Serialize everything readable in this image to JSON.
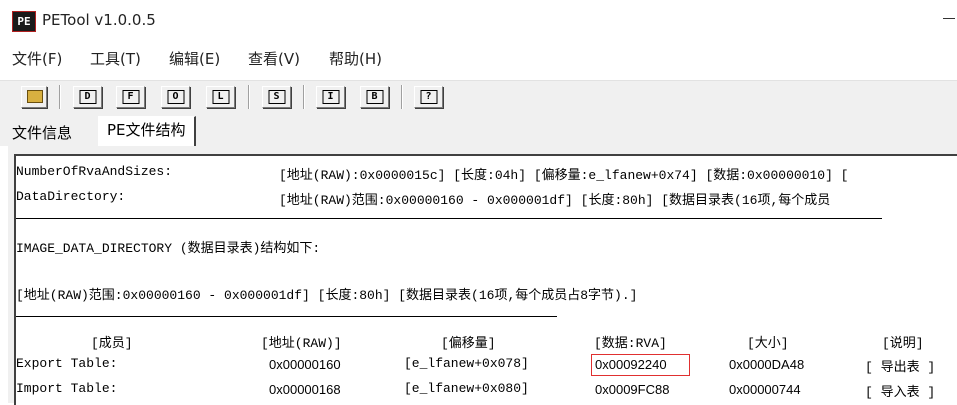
{
  "window": {
    "title": "PETool v1.0.0.5",
    "icon_text": "PE"
  },
  "menu": [
    {
      "label": "文件(F)"
    },
    {
      "label": "工具(T)"
    },
    {
      "label": "编辑(E)"
    },
    {
      "label": "查看(V)"
    },
    {
      "label": "帮助(H)"
    }
  ],
  "toolbar": {
    "buttons": [
      {
        "icon": "open-folder-icon",
        "letter": ""
      },
      {
        "icon": "d-icon",
        "letter": "D"
      },
      {
        "icon": "f-icon",
        "letter": "F"
      },
      {
        "icon": "o-icon",
        "letter": "O"
      },
      {
        "icon": "l-icon",
        "letter": "L"
      },
      {
        "icon": "s-icon",
        "letter": "S"
      },
      {
        "icon": "i-icon",
        "letter": "I"
      },
      {
        "icon": "b-icon",
        "letter": "B"
      },
      {
        "icon": "help-icon",
        "letter": "?"
      }
    ]
  },
  "tabs": [
    {
      "label": "文件信息",
      "active": false
    },
    {
      "label": "PE文件结构",
      "active": true
    }
  ],
  "content": {
    "line1_field": "NumberOfRvaAndSizes:",
    "line1_value": "[地址(RAW):0x0000015c] [长度:04h] [偏移量:e_lfanew+0x74] [数据:0x00000010] [",
    "line2_field": "DataDirectory:",
    "line2_value": "[地址(RAW)范围:0x00000160 - 0x000001df] [长度:80h] [数据目录表(16项,每个成员",
    "section_title": "IMAGE_DATA_DIRECTORY (数据目录表)结构如下:",
    "range_line": "[地址(RAW)范围:0x00000160 - 0x000001df] [长度:80h] [数据目录表(16项,每个成员占8字节).]",
    "table": {
      "headers": [
        "[成员]",
        "[地址(RAW)]",
        "[偏移量]",
        "[数据:RVA]",
        "[大小]",
        "[说明]"
      ],
      "rows": [
        {
          "member": "Export Table:",
          "addr": "0x00000160",
          "offset": "[e_lfanew+0x078]",
          "rva": "0x00092240",
          "size": "0x0000DA48",
          "desc": "[ 导出表 ]"
        },
        {
          "member": "Import Table:",
          "addr": "0x00000168",
          "offset": "[e_lfanew+0x080]",
          "rva": "0x0009FC88",
          "size": "0x00000744",
          "desc": "[ 导入表 ]"
        }
      ]
    },
    "highlight_color": "#e03030"
  }
}
